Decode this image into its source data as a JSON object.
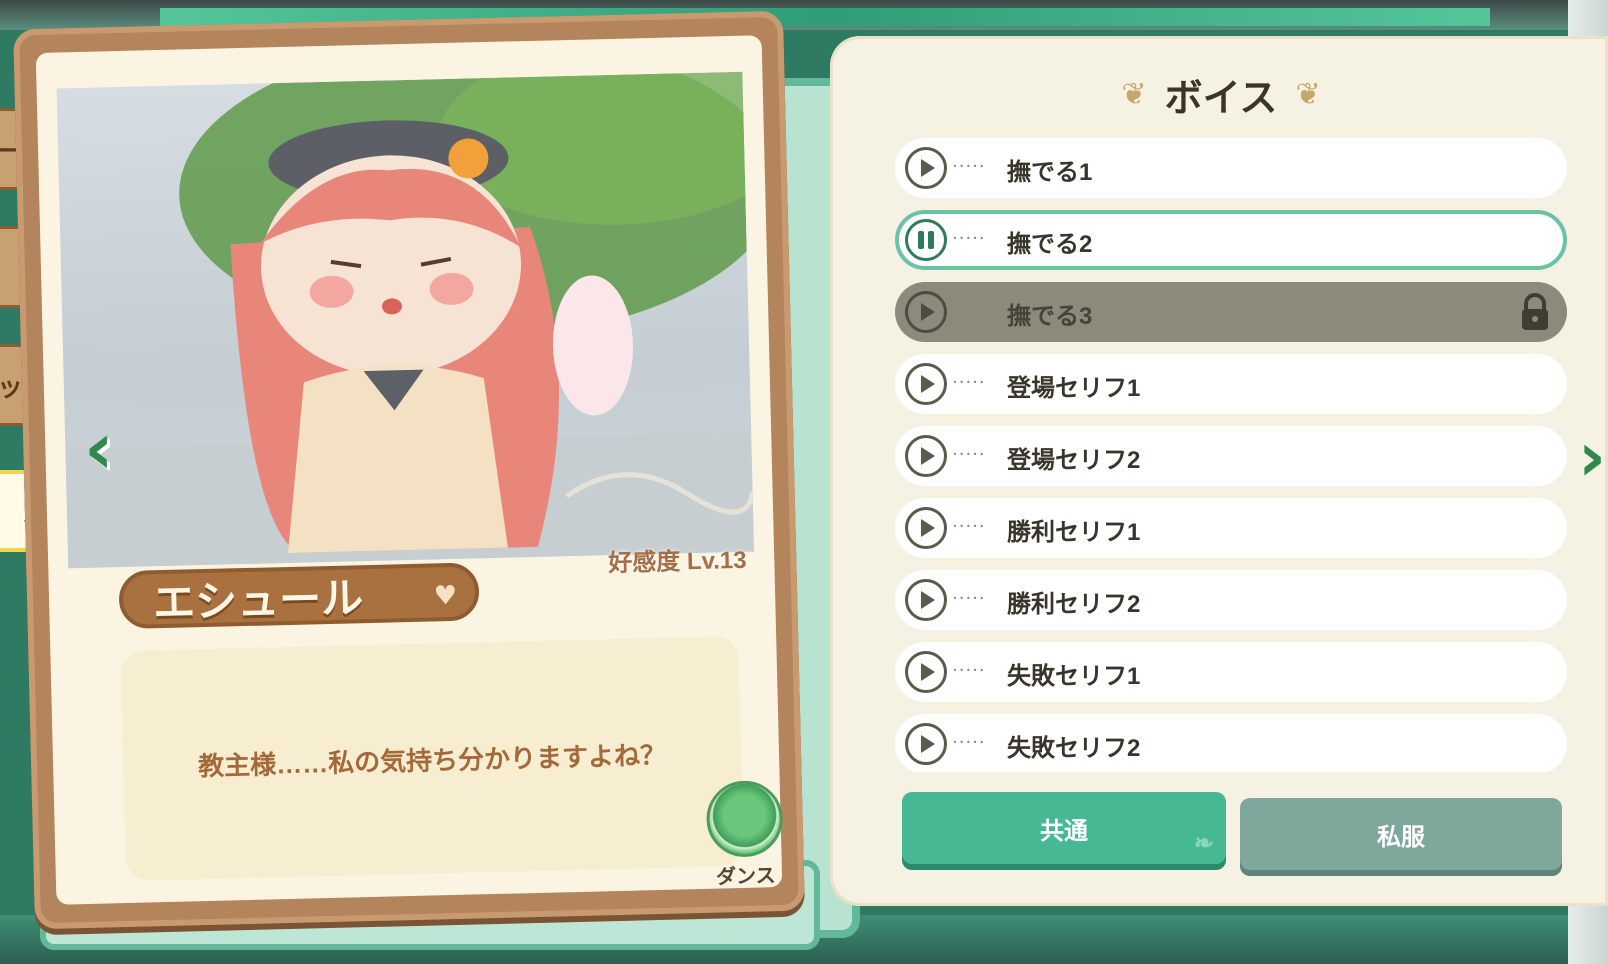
{
  "side_tabs": [
    {
      "label": "ール"
    },
    {
      "label": ""
    },
    {
      "label": "ップ"
    },
    {
      "label": "ス"
    }
  ],
  "character": {
    "name": "エシュール",
    "affinity": "好感度 Lv.13",
    "line": "教主様……私の気持ち分かりますよね？",
    "action_label": "ダンス"
  },
  "voice": {
    "title": "ボイス",
    "items": [
      {
        "label": "撫でる1",
        "state": "normal"
      },
      {
        "label": "撫でる2",
        "state": "playing"
      },
      {
        "label": "撫でる3",
        "state": "locked"
      },
      {
        "label": "登場セリフ1",
        "state": "normal"
      },
      {
        "label": "登場セリフ2",
        "state": "normal"
      },
      {
        "label": "勝利セリフ1",
        "state": "normal"
      },
      {
        "label": "勝利セリフ2",
        "state": "normal"
      },
      {
        "label": "失敗セリフ1",
        "state": "normal"
      },
      {
        "label": "失敗セリフ2",
        "state": "normal"
      }
    ],
    "dots": "·····"
  },
  "tabs": {
    "common": "共通",
    "casual": "私服"
  },
  "colors": {
    "accent_green": "#46b894",
    "card_brown": "#b4845c",
    "panel_cream": "#f5f2e4"
  }
}
